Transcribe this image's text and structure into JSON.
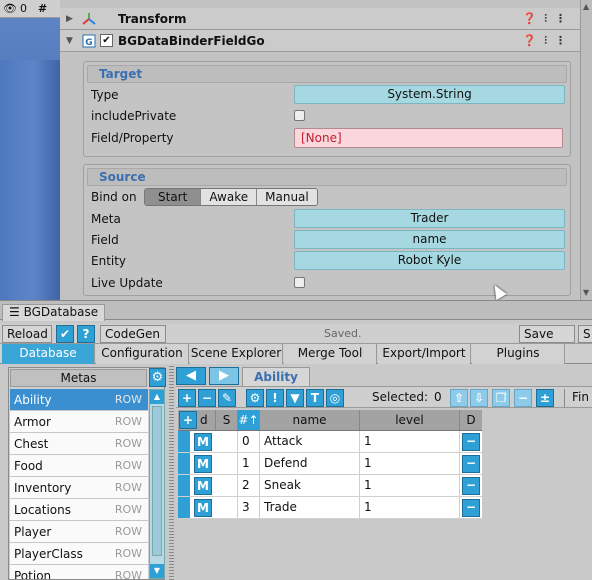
{
  "scene_toolbar": {
    "visibility_count": "0",
    "grid_icon": "#"
  },
  "inspector": {
    "components": [
      {
        "title": "Transform"
      },
      {
        "title": "BGDataBinderFieldGo"
      }
    ],
    "target": {
      "title": "Target",
      "type_label": "Type",
      "type_value": "System.String",
      "include_private_label": "includePrivate",
      "field_label": "Field/Property",
      "field_value": "[None]"
    },
    "source": {
      "title": "Source",
      "bind_on_label": "Bind on",
      "bind_on_options": [
        "Start",
        "Awake",
        "Manual"
      ],
      "bind_on_selected": "Start",
      "meta_label": "Meta",
      "meta_value": "Trader",
      "field_label": "Field",
      "field_value": "name",
      "entity_label": "Entity",
      "entity_value": "Robot Kyle",
      "live_update_label": "Live Update"
    }
  },
  "database": {
    "window_tab": "BGDatabase",
    "toolbar": {
      "reload": "Reload",
      "check": "✔",
      "help": "?",
      "codegen": "CodeGen",
      "saved": "Saved.",
      "save_all": "Save All",
      "s": "S"
    },
    "tabs": [
      "Database",
      "Configuration",
      "Scene Explorer",
      "Merge Tool",
      "Export/Import",
      "Plugins"
    ],
    "metas_header": "Metas",
    "metas": [
      {
        "name": "Ability",
        "tag": "ROW"
      },
      {
        "name": "Armor",
        "tag": "ROW"
      },
      {
        "name": "Chest",
        "tag": "ROW"
      },
      {
        "name": "Food",
        "tag": "ROW"
      },
      {
        "name": "Inventory",
        "tag": "ROW"
      },
      {
        "name": "Locations",
        "tag": "ROW"
      },
      {
        "name": "Player",
        "tag": "ROW"
      },
      {
        "name": "PlayerClass",
        "tag": "ROW"
      },
      {
        "name": "Potion",
        "tag": "ROW"
      }
    ],
    "meta_tab": "Ability",
    "selected_label": "Selected:",
    "selected_count": "0",
    "find_label": "Fin",
    "grid": {
      "headers": [
        "d",
        "S",
        "#↑",
        "name",
        "level",
        "D"
      ],
      "rows": [
        {
          "id": "0",
          "name": "Attack",
          "level": "1"
        },
        {
          "id": "1",
          "name": "Defend",
          "level": "1"
        },
        {
          "id": "2",
          "name": "Sneak",
          "level": "1"
        },
        {
          "id": "3",
          "name": "Trade",
          "level": "1"
        }
      ],
      "row_button": "M"
    }
  }
}
